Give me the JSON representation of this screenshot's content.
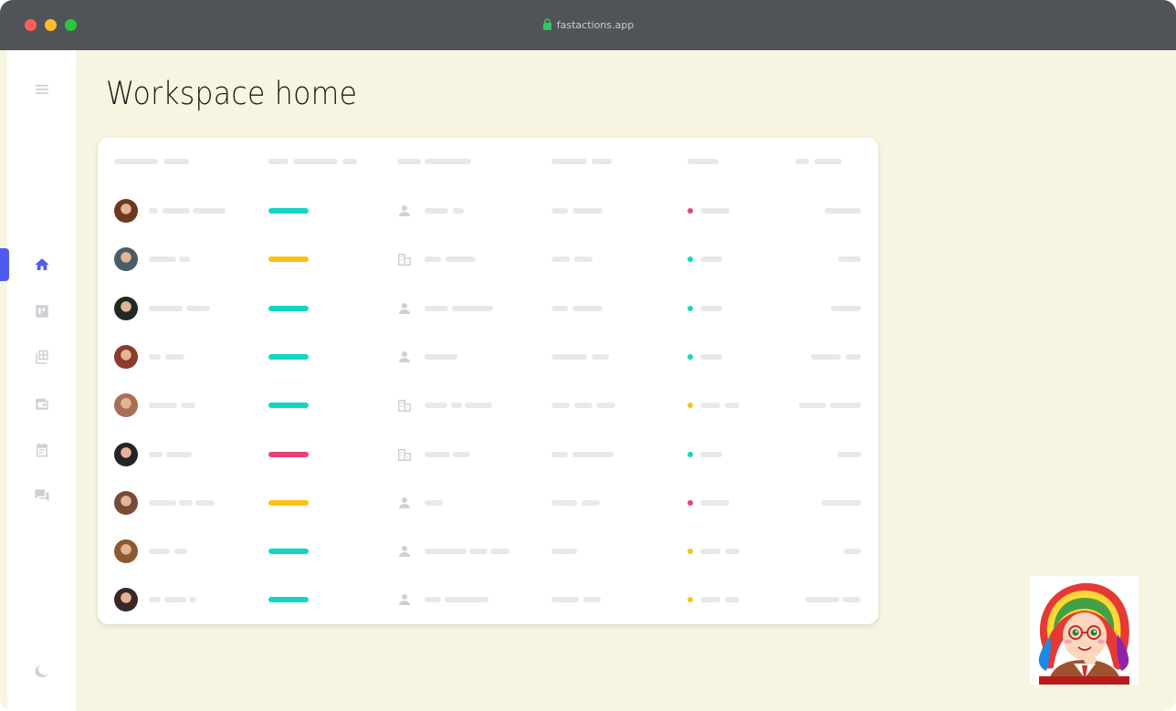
{
  "browser": {
    "url": "fastactions.app"
  },
  "page": {
    "title": "Workspace home"
  },
  "sidebar": {
    "items": [
      {
        "icon": "menu-icon"
      },
      {
        "icon": "home-icon",
        "active": true
      },
      {
        "icon": "board-icon"
      },
      {
        "icon": "table-icon"
      },
      {
        "icon": "wallet-icon"
      },
      {
        "icon": "calendar-icon"
      },
      {
        "icon": "chat-icon"
      },
      {
        "icon": "theme-moon-icon"
      }
    ]
  },
  "table": {
    "rows": [
      {
        "avatar_color": "#6b3a1f",
        "status_color": "#11d6c4",
        "type": "person-icon",
        "dot_color": "#ec407a"
      },
      {
        "avatar_color": "#4a5d66",
        "status_color": "#fec014",
        "type": "building-icon",
        "dot_color": "#11d6c4"
      },
      {
        "avatar_color": "#1f2a22",
        "status_color": "#11d6c4",
        "type": "person-icon",
        "dot_color": "#11d6c4"
      },
      {
        "avatar_color": "#8a3b2a",
        "status_color": "#11d6c4",
        "type": "person-icon",
        "dot_color": "#11d6c4"
      },
      {
        "avatar_color": "#a86f55",
        "status_color": "#11d6c4",
        "type": "building-icon",
        "dot_color": "#f5c518"
      },
      {
        "avatar_color": "#252525",
        "status_color": "#ec407a",
        "type": "building-icon",
        "dot_color": "#11d6c4"
      },
      {
        "avatar_color": "#7a4a38",
        "status_color": "#fec014",
        "type": "person-icon",
        "dot_color": "#ec407a"
      },
      {
        "avatar_color": "#8b5a30",
        "status_color": "#11d6c4",
        "type": "person-icon",
        "dot_color": "#f5c518"
      },
      {
        "avatar_color": "#3a2826",
        "status_color": "#11d6c4",
        "type": "person-icon",
        "dot_color": "#f5c518"
      }
    ]
  },
  "colors": {
    "background": "#f7f5e1",
    "accent": "#4f5bf0",
    "titlebar": "#505358",
    "placeholder": "#e6e8ec"
  }
}
